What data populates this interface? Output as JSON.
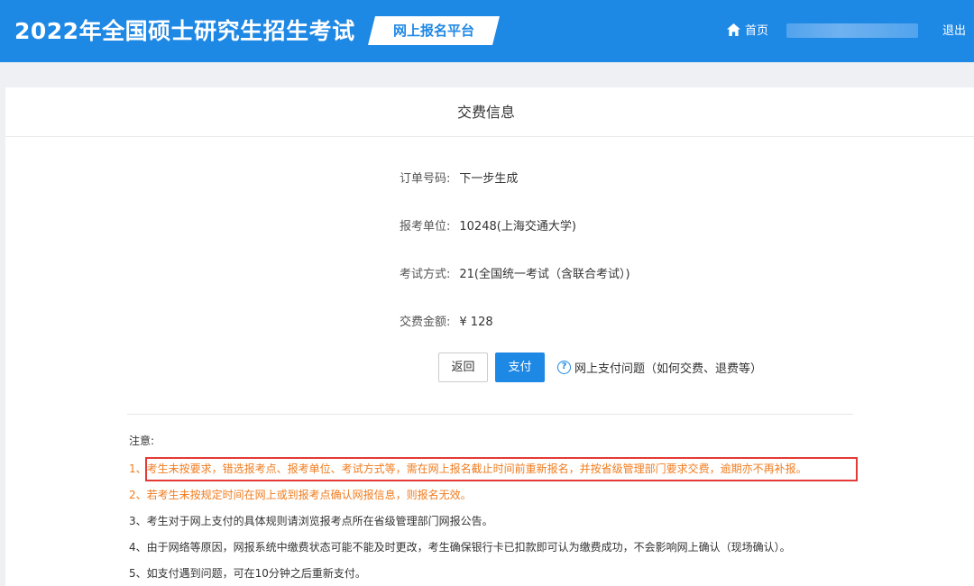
{
  "header": {
    "site_title": "2022年全国硕士研究生招生考试",
    "platform_tag": "网上报名平台",
    "home_label": "首页",
    "logout_label": "退出"
  },
  "panel": {
    "title": "交费信息"
  },
  "info": [
    {
      "label": "订单号码:",
      "value": "下一步生成"
    },
    {
      "label": "报考单位:",
      "value": "10248(上海交通大学)"
    },
    {
      "label": "考试方式:",
      "value": "21(全国统一考试（含联合考试）)"
    },
    {
      "label": "交费金额:",
      "value": "¥ 128"
    }
  ],
  "actions": {
    "back_label": "返回",
    "pay_label": "支付",
    "help_label": "网上支付问题（如何交费、退费等）",
    "help_icon_glyph": "?"
  },
  "notice": {
    "title": "注意:",
    "items": [
      "1、考生未按要求，错选报考点、报考单位、考试方式等，需在网上报名截止时间前重新报名，并按省级管理部门要求交费，逾期亦不再补报。",
      "2、若考生未按规定时间在网上或到报考点确认网报信息，则报名无效。",
      "3、考生对于网上支付的具体规则请浏览报考点所在省级管理部门网报公告。",
      "4、由于网络等原因，网报系统中缴费状态可能不能及时更改，考生确保银行卡已扣款即可认为缴费成功，不会影响网上确认（现场确认）。",
      "5、如支付遇到问题，可在10分钟之后重新支付。"
    ]
  },
  "colors": {
    "brand_blue": "#1e88e5",
    "warning_orange": "#f07c1f",
    "highlight_red": "#e53935"
  },
  "icons": {
    "home": "home-icon",
    "help": "help-circle-icon"
  }
}
